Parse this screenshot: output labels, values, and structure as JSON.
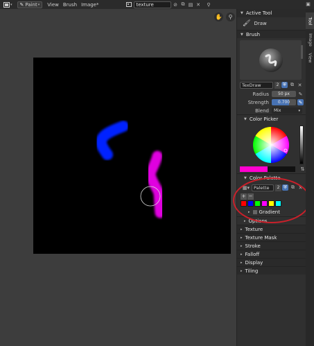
{
  "header": {
    "mode": "Paint",
    "menus": [
      "View",
      "Brush",
      "Image*"
    ],
    "image_name": "texture"
  },
  "sidebar": {
    "active_tool": {
      "title": "Active Tool",
      "tool_name": "Draw"
    },
    "brush": {
      "title": "Brush",
      "name": "TexDraw",
      "users": "2",
      "radius_label": "Radius",
      "radius_value": "50 px",
      "strength_label": "Strength",
      "strength_value": "0.700",
      "strength_fraction": 0.7,
      "blend_label": "Blend",
      "blend_value": "Mix"
    },
    "color_picker": {
      "title": "Color Picker",
      "current_color": "#ff00d0"
    },
    "color_palette": {
      "title": "Color Palette",
      "name": "Palette",
      "users": "2",
      "add": "+",
      "remove": "−",
      "colors": [
        "#ff0000",
        "#0000ff",
        "#00ff00",
        "#ff00ff",
        "#ffff00",
        "#00ffff"
      ]
    },
    "gradient_label": "Gradient",
    "sections": [
      "Options",
      "Texture",
      "Texture Mask",
      "Stroke",
      "Falloff",
      "Display",
      "Tiling"
    ]
  },
  "tabs": [
    "Tool",
    "Image",
    "View"
  ],
  "canvas": {
    "background": "#000000",
    "strokes": [
      {
        "color": "#0024ff",
        "name": "blue-stroke"
      },
      {
        "color": "#e000e0",
        "name": "magenta-stroke"
      }
    ]
  }
}
